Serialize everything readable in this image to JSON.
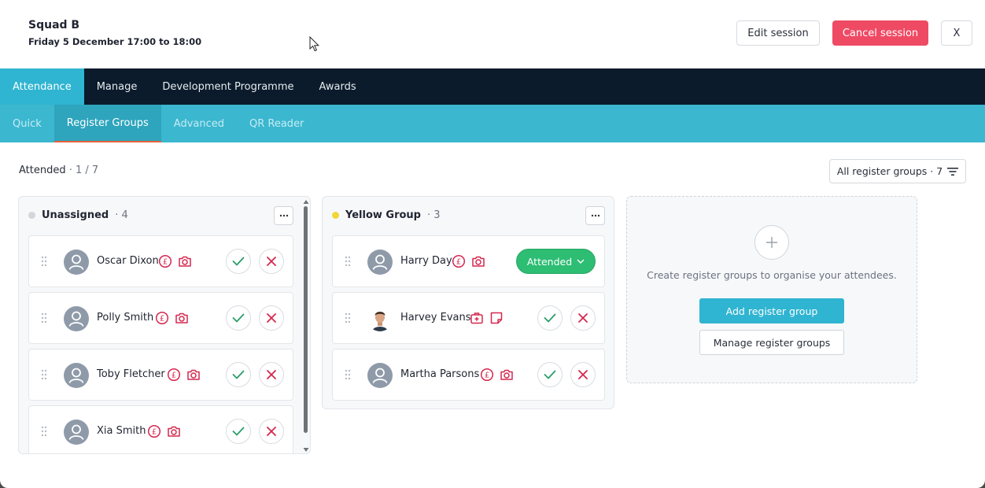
{
  "header": {
    "title": "Squad B",
    "subtitle": "Friday 5 December 17:00 to 18:00",
    "edit_label": "Edit session",
    "cancel_label": "Cancel session",
    "close_label": "X"
  },
  "nav": {
    "primary": [
      "Attendance",
      "Manage",
      "Development Programme",
      "Awards"
    ],
    "secondary": [
      "Quick",
      "Register Groups",
      "Advanced",
      "QR Reader"
    ]
  },
  "toolbar": {
    "attended_label": "Attended",
    "attended_sep": " · ",
    "attended_value": "1 / 7",
    "filter_label": "All register groups · 7"
  },
  "groups": [
    {
      "name": "Unassigned",
      "count": "· 4",
      "dot_color": "#d3d6da",
      "members": [
        {
          "name": "Oscar Dixon"
        },
        {
          "name": "Polly Smith"
        },
        {
          "name": "Toby Fletcher"
        },
        {
          "name": "Xia Smith"
        }
      ]
    },
    {
      "name": "Yellow Group",
      "count": "· 3",
      "dot_color": "#f2d637",
      "members": [
        {
          "name": "Harry Day",
          "status": "Attended"
        },
        {
          "name": "Harvey Evans"
        },
        {
          "name": "Martha Parsons"
        }
      ]
    }
  ],
  "create": {
    "text": "Create register groups to organise your attendees.",
    "add_label": "Add register group",
    "manage_label": "Manage register groups"
  },
  "colors": {
    "accent": "#2fb4d1",
    "nav_dark": "#0b1b2b",
    "danger": "#ef4a64",
    "success": "#2dbd73",
    "icon_red": "#d4284f"
  }
}
